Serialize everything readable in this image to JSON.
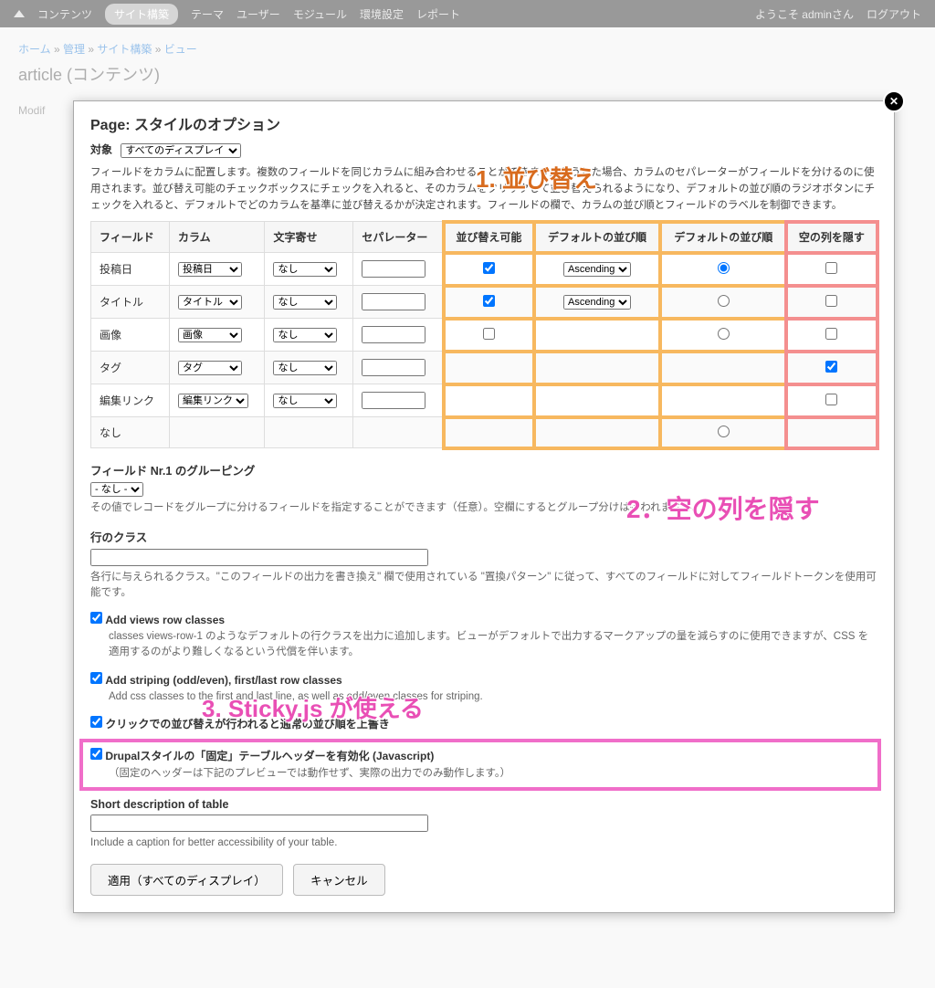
{
  "topbar": {
    "items": [
      "コンテンツ",
      "サイト構築",
      "テーマ",
      "ユーザー",
      "モジュール",
      "環境設定",
      "レポート"
    ],
    "welcome": "ようこそ adminさん",
    "logout": "ログアウト"
  },
  "breadcrumb": {
    "parts": [
      "ホーム",
      "管理",
      "サイト構築",
      "ビュー"
    ],
    "sep": " » "
  },
  "page_title": "article (コンテンツ)",
  "bg_label": "Modif",
  "dialog": {
    "title": "Page: スタイルのオプション",
    "scope_label": "対象",
    "scope_value": "すべてのディスプレイ",
    "desc": "フィールドをカラムに配置します。複数のフィールドを同じカラムに組み合わせることができます。そうした場合、カラムのセパレーターがフィールドを分けるのに使用されます。並び替え可能のチェックボックスにチェックを入れると、そのカラムをクリックして並び替えられるようになり、デフォルトの並び順のラジオボタンにチェックを入れると、デフォルトでどのカラムを基準に並び替えるかが決定されます。フィールドの欄で、カラムの並び順とフィールドのラベルを制御できます。",
    "headers": {
      "field": "フィールド",
      "column": "カラム",
      "align": "文字寄せ",
      "sep": "セパレーター",
      "sortable": "並び替え可能",
      "default_order": "デフォルトの並び順",
      "default_sort": "デフォルトの並び順",
      "hide_empty": "空の列を隠す"
    },
    "align_opt": "なし",
    "order_opt": "Ascending",
    "rows": [
      {
        "field": "投稿日",
        "column": "投稿日",
        "sortable": true,
        "has_order": true,
        "default_radio": true,
        "hide": false
      },
      {
        "field": "タイトル",
        "column": "タイトル",
        "sortable": true,
        "has_order": true,
        "default_radio": false,
        "hide": false
      },
      {
        "field": "画像",
        "column": "画像",
        "sortable": false,
        "has_order": false,
        "default_radio": false,
        "hide": false
      },
      {
        "field": "タグ",
        "column": "タグ",
        "sortable": null,
        "has_order": false,
        "default_radio": null,
        "hide": true
      },
      {
        "field": "編集リンク",
        "column": "編集リンク",
        "sortable": null,
        "has_order": false,
        "default_radio": null,
        "hide": false
      },
      {
        "field": "なし",
        "column": null,
        "sortable": null,
        "has_order": false,
        "default_radio": false,
        "hide": null
      }
    ],
    "grouping": {
      "label": "フィールド Nr.1 のグルーピング",
      "value": "- なし -",
      "desc": "その値でレコードをグループに分けるフィールドを指定することができます（任意）。空欄にするとグループ分けは行われません。"
    },
    "row_class": {
      "label": "行のクラス",
      "desc": "各行に与えられるクラス。\"このフィールドの出力を書き換え\" 欄で使用されている \"置換パターン\" に従って、すべてのフィールドに対してフィールドトークンを使用可能です。"
    },
    "opts": {
      "add_rows": {
        "label": "Add views row classes",
        "desc": "classes views-row-1 のようなデフォルトの行クラスを出力に追加します。ビューがデフォルトで出力するマークアップの量を減らすのに使用できますが、CSS を適用するのがより難しくなるという代償を伴います。"
      },
      "striping": {
        "label": "Add striping (odd/even), first/last row classes",
        "desc": "Add css classes to the first and last line, as well as odd/even classes for striping."
      },
      "click_sort": {
        "label": "クリックでの並び替えが行われると通常の並び順を上書き"
      },
      "sticky": {
        "label": "Drupalスタイルの「固定」テーブルヘッダーを有効化 (Javascript)",
        "desc": "（固定のヘッダーは下記のプレビューでは動作せず、実際の出力でのみ動作します。）"
      }
    },
    "short_desc": {
      "label": "Short description of table",
      "desc": "Include a caption for better accessibility of your table."
    },
    "apply": "適用（すべてのディスプレイ）",
    "cancel": "キャンセル"
  },
  "annotations": {
    "a1": "1. 並び替え",
    "a2": "2．空の列を隠す",
    "a3": "3. Sticky.js が使える"
  }
}
